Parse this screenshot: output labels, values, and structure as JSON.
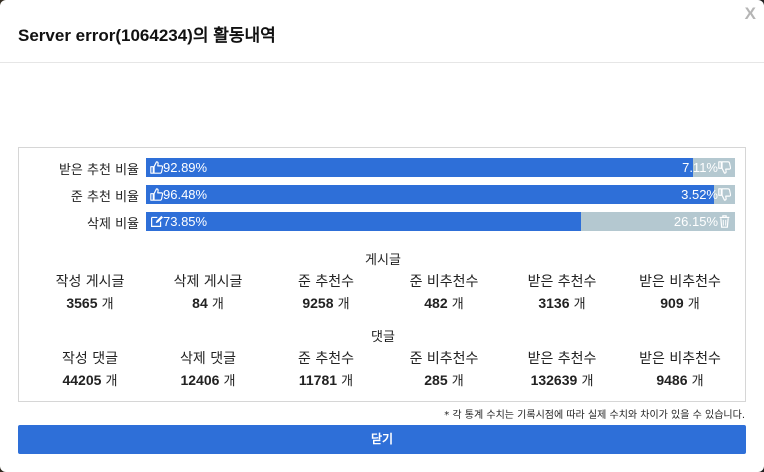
{
  "modal": {
    "title": "Server error(1064234)의 활동내역",
    "close_label": "X"
  },
  "ratios": [
    {
      "label": "받은 추천 비율",
      "left_text": "92.89%",
      "right_text": "7.11%",
      "fill": 92.89,
      "left_icon": "thumbs-up-icon",
      "right_icon": "thumbs-down-icon"
    },
    {
      "label": "준 추천 비율",
      "left_text": "96.48%",
      "right_text": "3.52%",
      "fill": 96.48,
      "left_icon": "thumbs-up-icon",
      "right_icon": "thumbs-down-icon"
    },
    {
      "label": "삭제 비율",
      "left_text": "73.85%",
      "right_text": "26.15%",
      "fill": 73.85,
      "left_icon": "edit-icon",
      "right_icon": "trash-icon"
    }
  ],
  "posts": {
    "title": "게시글",
    "unit": "개",
    "items": [
      {
        "label": "작성 게시글",
        "value": "3565"
      },
      {
        "label": "삭제 게시글",
        "value": "84"
      },
      {
        "label": "준 추천수",
        "value": "9258"
      },
      {
        "label": "준 비추천수",
        "value": "482"
      },
      {
        "label": "받은 추천수",
        "value": "3136"
      },
      {
        "label": "받은 비추천수",
        "value": "909"
      }
    ]
  },
  "comments": {
    "title": "댓글",
    "unit": "개",
    "items": [
      {
        "label": "작성 댓글",
        "value": "44205"
      },
      {
        "label": "삭제 댓글",
        "value": "12406"
      },
      {
        "label": "준 추천수",
        "value": "11781"
      },
      {
        "label": "준 비추천수",
        "value": "285"
      },
      {
        "label": "받은 추천수",
        "value": "132639"
      },
      {
        "label": "받은 비추천수",
        "value": "9486"
      }
    ]
  },
  "footnote": "* 각 통계 수치는 기록시점에 따라 실제 수치와 차이가 있을 수 있습니다.",
  "confirm_label": "닫기",
  "colors": {
    "accent": "#2e6fd8",
    "bar_track": "#b4c8d0"
  }
}
